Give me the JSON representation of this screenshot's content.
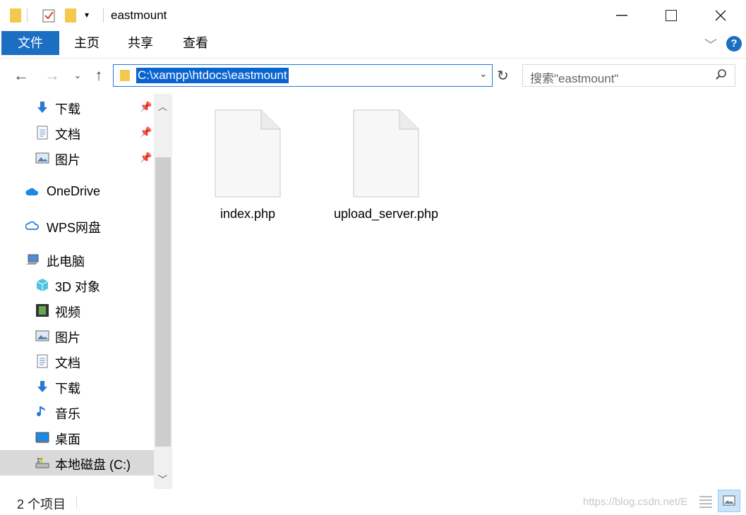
{
  "window": {
    "title": "eastmount"
  },
  "ribbon": {
    "tabs": [
      "文件",
      "主页",
      "共享",
      "查看"
    ]
  },
  "address": {
    "path": "C:\\xampp\\htdocs\\eastmount"
  },
  "search": {
    "placeholder": "搜索\"eastmount\""
  },
  "nav": {
    "quick_access": [
      {
        "label": "下载",
        "icon": "download-arrow-icon",
        "pinned": true
      },
      {
        "label": "文档",
        "icon": "document-icon",
        "pinned": true
      },
      {
        "label": "图片",
        "icon": "pictures-icon",
        "pinned": true
      }
    ],
    "onedrive": "OneDrive",
    "wps": "WPS网盘",
    "this_pc": "此电脑",
    "pc_items": [
      {
        "label": "3D 对象",
        "icon": "cube-3d-icon"
      },
      {
        "label": "视频",
        "icon": "video-icon"
      },
      {
        "label": "图片",
        "icon": "pictures-icon"
      },
      {
        "label": "文档",
        "icon": "document-icon"
      },
      {
        "label": "下载",
        "icon": "download-arrow-icon"
      },
      {
        "label": "音乐",
        "icon": "music-note-icon"
      },
      {
        "label": "桌面",
        "icon": "desktop-icon"
      },
      {
        "label": "本地磁盘 (C:)",
        "icon": "drive-icon",
        "selected": true
      }
    ]
  },
  "files": [
    {
      "name": "index.php"
    },
    {
      "name": "upload_server.php"
    }
  ],
  "status": {
    "item_count": "2 个项目"
  },
  "watermark": "https://blog.csdn.net/E",
  "colors": {
    "accent": "#1b6ec2",
    "selection": "#0a64d0"
  }
}
